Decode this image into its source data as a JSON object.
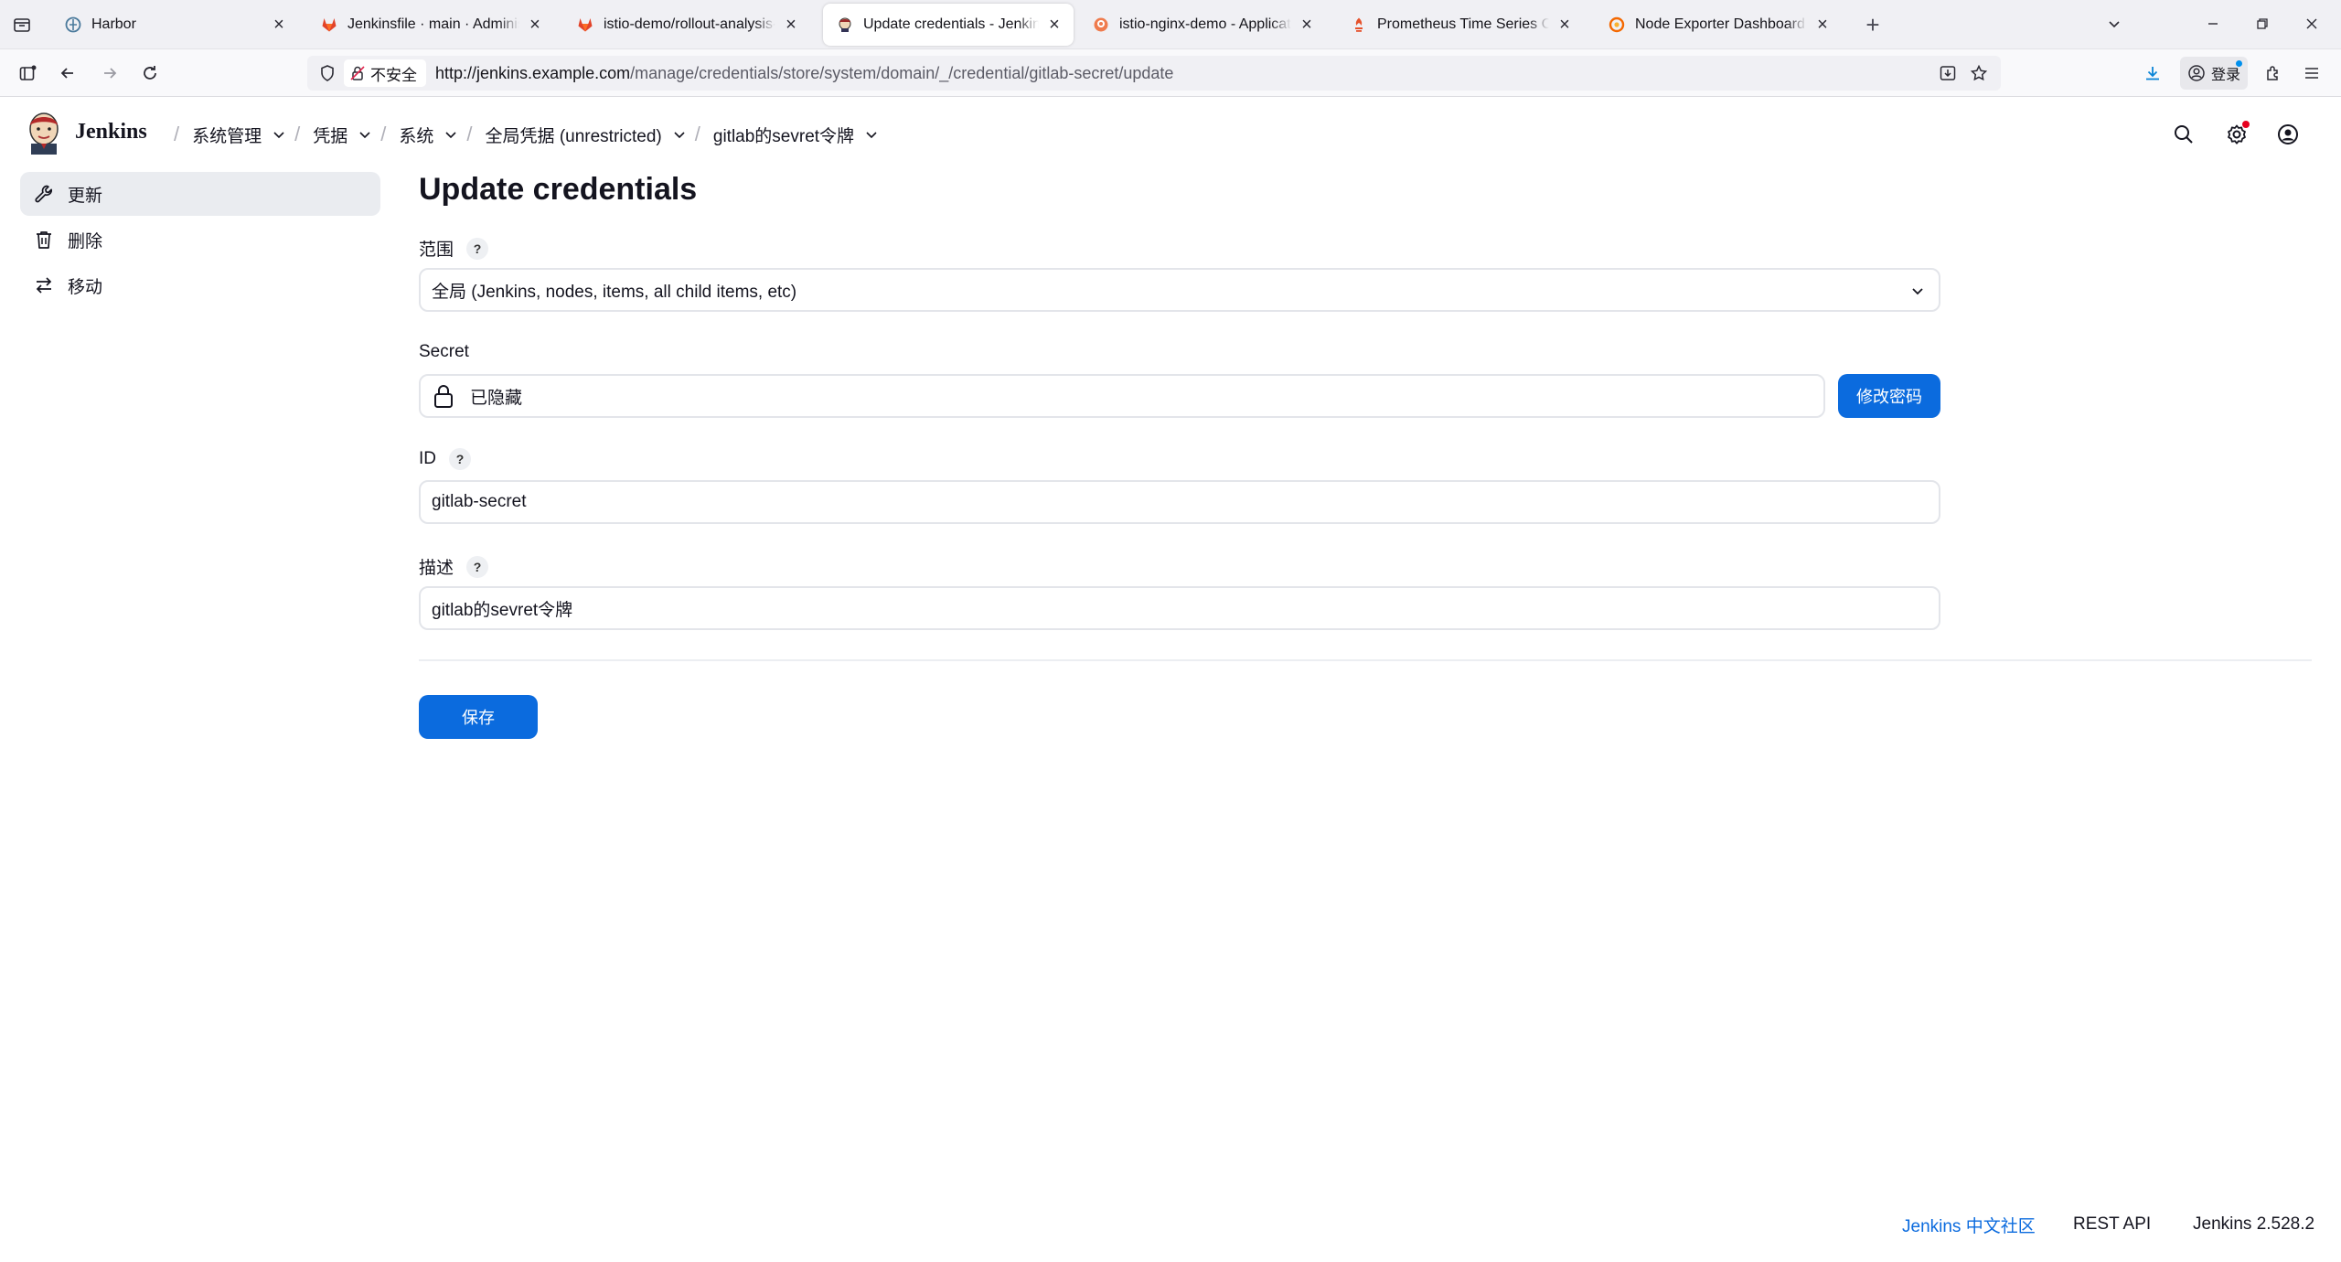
{
  "browser": {
    "tabs": [
      {
        "title": "Harbor",
        "icon": "harbor-icon"
      },
      {
        "title": "Jenkinsfile · main · Administrator",
        "icon": "gitlab-icon"
      },
      {
        "title": "istio-demo/rollout-analysis-template",
        "icon": "gitlab-icon"
      },
      {
        "title": "Update credentials - Jenkins",
        "icon": "jenkins-icon",
        "active": true
      },
      {
        "title": "istio-nginx-demo - Application",
        "icon": "argo-icon"
      },
      {
        "title": "Prometheus Time Series Collection",
        "icon": "prometheus-icon"
      },
      {
        "title": "Node Exporter Dashboard EN",
        "icon": "grafana-icon"
      }
    ],
    "new_tab_symbol": "+",
    "close_symbol": "×",
    "security_label": "不安全",
    "url_host": "http://jenkins.example.com",
    "url_path": "/manage/credentials/store/system/domain/_/credential/gitlab-secret/update",
    "account_label": "登录"
  },
  "jenkins": {
    "brand": "Jenkins",
    "breadcrumbs": [
      {
        "label": "系统管理"
      },
      {
        "label": "凭据"
      },
      {
        "label": "系统"
      },
      {
        "label": "全局凭据 (unrestricted)"
      },
      {
        "label": "gitlab的sevret令牌"
      }
    ]
  },
  "sidebar": {
    "items": [
      {
        "label": "更新",
        "icon": "wrench-icon",
        "active": true
      },
      {
        "label": "删除",
        "icon": "trash-icon"
      },
      {
        "label": "移动",
        "icon": "move-arrows-icon"
      }
    ]
  },
  "form": {
    "title": "Update credentials",
    "help_symbol": "?",
    "scope": {
      "label": "范围",
      "value": "全局 (Jenkins, nodes, items, all child items, etc)"
    },
    "secret": {
      "label": "Secret",
      "value": "已隐藏",
      "button": "修改密码"
    },
    "id": {
      "label": "ID",
      "value": "gitlab-secret"
    },
    "description": {
      "label": "描述",
      "value": "gitlab的sevret令牌"
    },
    "save_button": "保存"
  },
  "footer": {
    "community_link": "Jenkins 中文社区",
    "rest_api": "REST API",
    "version": "Jenkins 2.528.2"
  },
  "colors": {
    "accent": "#0b6bde",
    "tabstrip_bg": "#f0f0f4",
    "sidebar_active_bg": "#eaecf0"
  }
}
